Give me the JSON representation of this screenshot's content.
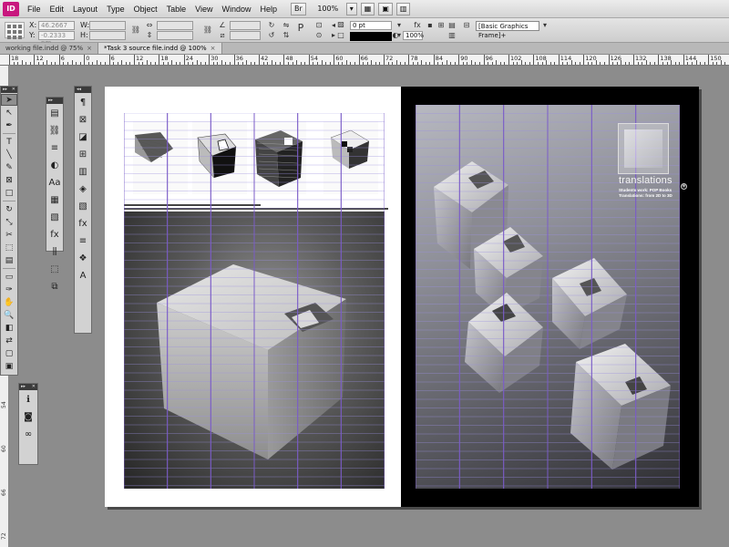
{
  "app": {
    "logo_text": "ID"
  },
  "menu": [
    "File",
    "Edit",
    "Layout",
    "Type",
    "Object",
    "Table",
    "View",
    "Window",
    "Help"
  ],
  "menubar_right": {
    "br_label": "Br",
    "zoom": "100%"
  },
  "control": {
    "x_label": "X:",
    "x_value": "46.2667 pm",
    "y_label": "Y:",
    "y_value": "-0.2333 pm",
    "w_label": "W:",
    "h_label": "H:",
    "stroke_weight": "0 pt",
    "opacity": "100%",
    "frame_style": "[Basic Graphics Frame]+"
  },
  "tabs": [
    {
      "label": "working file.indd @ 75%",
      "close": "×",
      "active": false
    },
    {
      "label": "*Task 3 source file.indd @ 100%",
      "close": "×",
      "active": true
    }
  ],
  "ruler": {
    "labels": [
      "18",
      "12",
      "6",
      "0",
      "6",
      "12",
      "18",
      "24",
      "30",
      "36",
      "42",
      "48",
      "54",
      "60",
      "66",
      "72",
      "78",
      "84",
      "90",
      "96",
      "102",
      "108",
      "114",
      "120",
      "126",
      "132",
      "138",
      "144",
      "150"
    ]
  },
  "vruler": {
    "labels": [
      "12",
      "18",
      "24",
      "30",
      "36",
      "42",
      "48",
      "54",
      "60",
      "66",
      "72"
    ]
  },
  "toolbox": {
    "tools": [
      {
        "name": "selection-tool",
        "glyph": "➤",
        "selected": true
      },
      {
        "name": "direct-selection-tool",
        "glyph": "↖"
      },
      {
        "name": "pen-tool",
        "glyph": "✒"
      },
      {
        "name": "type-tool",
        "glyph": "T"
      },
      {
        "name": "line-tool",
        "glyph": "╲"
      },
      {
        "name": "pencil-tool",
        "glyph": "✎"
      },
      {
        "name": "rectangle-frame-tool",
        "glyph": "⊠"
      },
      {
        "name": "rectangle-tool",
        "glyph": "□"
      },
      {
        "name": "rotate-tool",
        "glyph": "↻"
      },
      {
        "name": "scale-tool",
        "glyph": "⤡"
      },
      {
        "name": "scissors-tool",
        "glyph": "✂"
      },
      {
        "name": "free-transform-tool",
        "glyph": "⬚"
      },
      {
        "name": "gradient-swatch-tool",
        "glyph": "▤"
      },
      {
        "name": "note-tool",
        "glyph": "▭"
      },
      {
        "name": "eyedropper-tool",
        "glyph": "✑"
      },
      {
        "name": "hand-tool",
        "glyph": "✋"
      },
      {
        "name": "zoom-tool",
        "glyph": "🔍"
      }
    ]
  },
  "panel_a": {
    "icons": [
      "pages-icon",
      "links-icon",
      "stroke-icon",
      "color-icon",
      "character-styles-icon",
      "swatches-icon",
      "gradient-icon",
      "effects-icon",
      "align-icon",
      "transform-icon",
      "pathfinder-icon"
    ]
  },
  "panel_b": {
    "icons": [
      "paragraph-icon",
      "text-wrap-icon",
      "object-styles-icon",
      "table-icon",
      "cell-styles-icon",
      "layers-icon",
      "gradient-icon",
      "effects-icon",
      "stroke-icon",
      "layers-stack-icon",
      "character-icon"
    ]
  },
  "panel_c": {
    "icons": [
      "info-icon",
      "swatch-icon",
      "hyperlinks-icon"
    ]
  },
  "document": {
    "brand_title": "translations",
    "brand_sub_1": "Students work: POP Books",
    "brand_sub_2": "Translations: from 2D to 3D",
    "anchor": "◉"
  },
  "colors": {
    "grid_col": "#7b5cc8",
    "grid_row": "#9a8fe0",
    "accent": "#c8177e"
  }
}
